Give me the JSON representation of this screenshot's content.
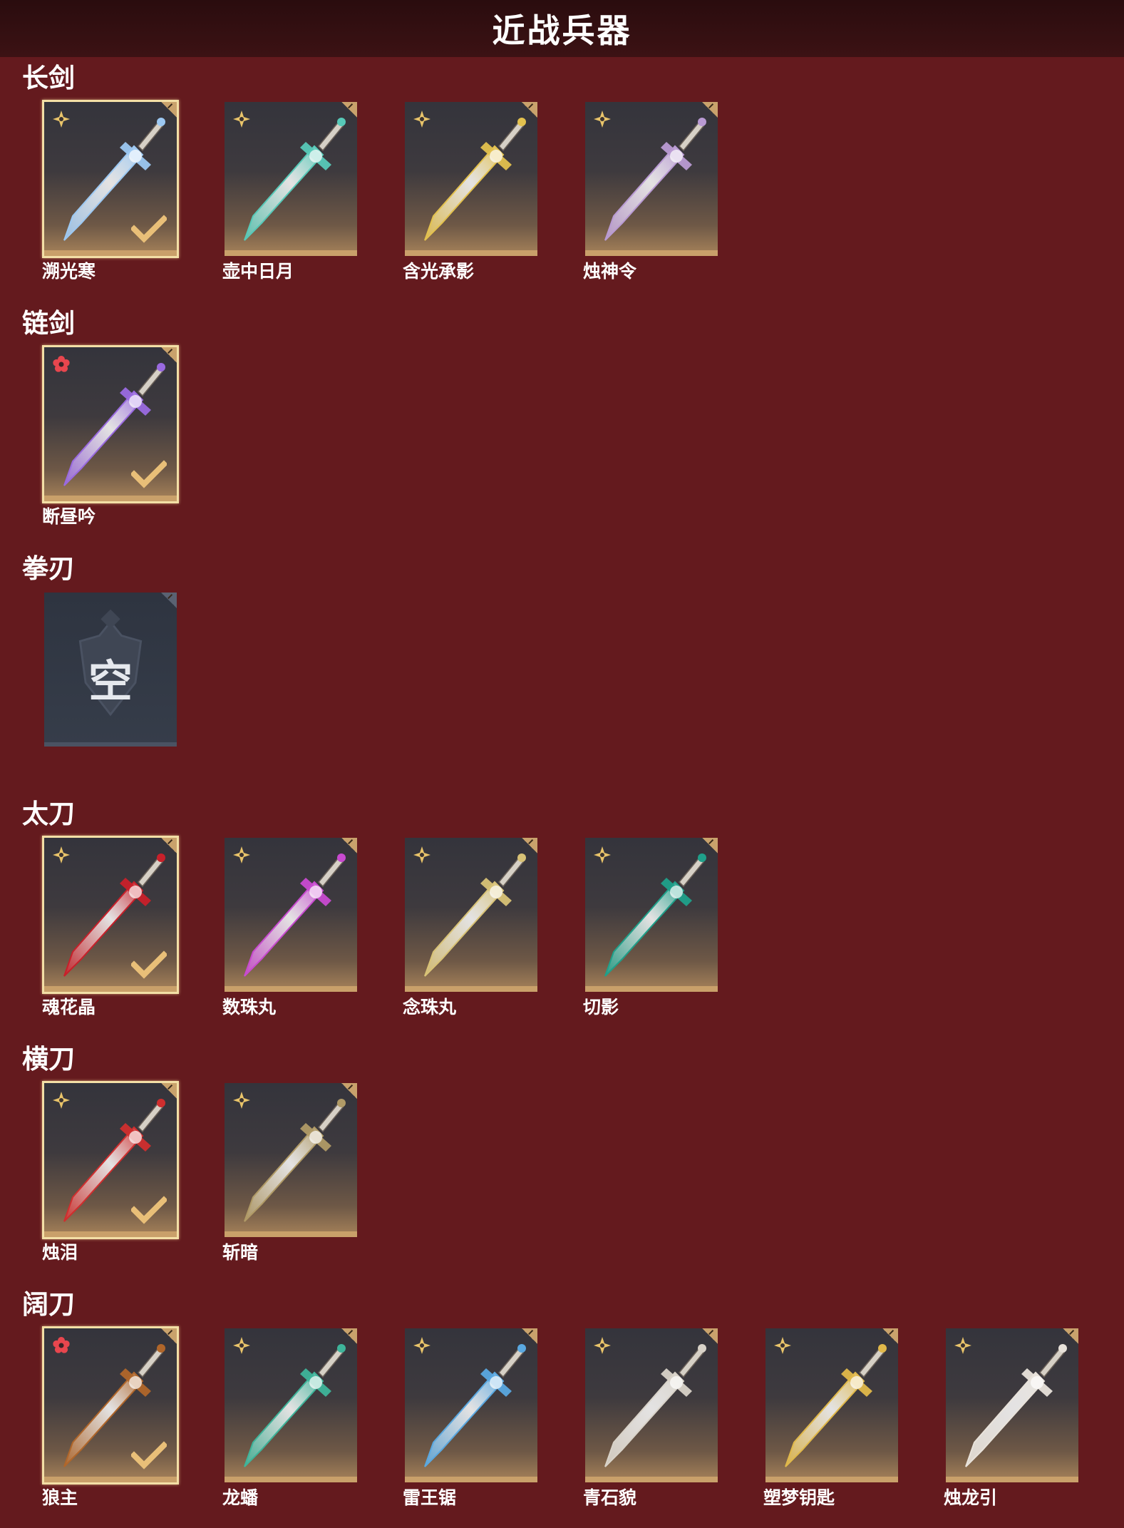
{
  "page": {
    "title": "近战兵器"
  },
  "colors": {
    "background": "#641a1e",
    "titlebar": "#2a0c0e",
    "frame": "#c9a06a",
    "equipped_border": "#f3dfa6",
    "check": "#e9bf78"
  },
  "sections": [
    {
      "name": "长剑",
      "items": [
        {
          "name": "溯光寒",
          "quality": "gold",
          "equipped": true,
          "color": "#9cc8f2"
        },
        {
          "name": "壶中日月",
          "quality": "gold",
          "equipped": false,
          "color": "#57c9b8"
        },
        {
          "name": "含光承影",
          "quality": "gold",
          "equipped": false,
          "color": "#e3c14e"
        },
        {
          "name": "烛神令",
          "quality": "gold",
          "equipped": false,
          "color": "#b99ad3"
        }
      ]
    },
    {
      "name": "链剑",
      "items": [
        {
          "name": "断昼吟",
          "quality": "red",
          "equipped": true,
          "color": "#9a6ae0"
        }
      ]
    },
    {
      "name": "拳刃",
      "items": [
        {
          "name": "",
          "empty": true,
          "empty_text": "空"
        }
      ]
    },
    {
      "name": "太刀",
      "items": [
        {
          "name": "魂花晶",
          "quality": "gold",
          "equipped": true,
          "color": "#c8202a"
        },
        {
          "name": "数珠丸",
          "quality": "gold",
          "equipped": false,
          "color": "#c84ad0"
        },
        {
          "name": "念珠丸",
          "quality": "gold",
          "equipped": false,
          "color": "#d8c276"
        },
        {
          "name": "切影",
          "quality": "gold",
          "equipped": false,
          "color": "#1fa08a"
        }
      ]
    },
    {
      "name": "横刀",
      "items": [
        {
          "name": "烛泪",
          "quality": "gold",
          "equipped": true,
          "color": "#d02e2e"
        },
        {
          "name": "斩暗",
          "quality": "gold",
          "equipped": false,
          "color": "#b09a66"
        }
      ]
    },
    {
      "name": "阔刀",
      "items": [
        {
          "name": "狼主",
          "quality": "red",
          "equipped": true,
          "color": "#b0662a"
        },
        {
          "name": "龙蟠",
          "quality": "gold",
          "equipped": false,
          "color": "#3eb49a"
        },
        {
          "name": "雷王锯",
          "quality": "gold",
          "equipped": false,
          "color": "#5aa8e0"
        },
        {
          "name": "青石貌",
          "quality": "gold",
          "equipped": false,
          "color": "#d8d2c8"
        },
        {
          "name": "塑梦钥匙",
          "quality": "gold",
          "equipped": false,
          "color": "#e0b84a"
        },
        {
          "name": "烛龙引",
          "quality": "gold",
          "equipped": false,
          "color": "#e8e2da"
        }
      ]
    }
  ]
}
